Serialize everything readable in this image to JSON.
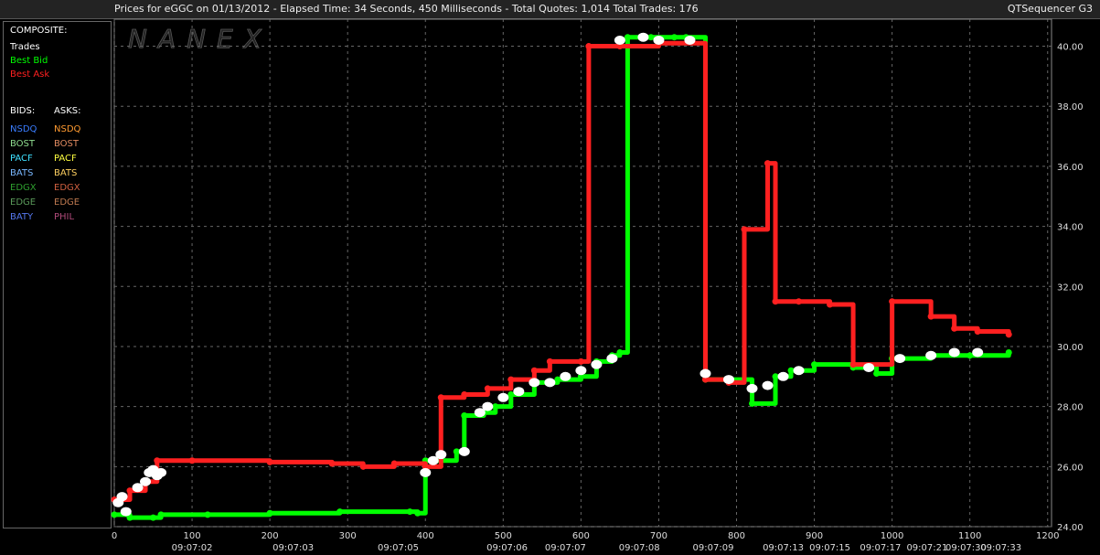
{
  "header": {
    "title": "Prices for  eGGC  on  01/13/2012  -  Elapsed Time: 34 Seconds, 450 Milliseconds  -  Total Quotes: 1,014  Total Trades: 176",
    "app_name": "QTSequencer G3"
  },
  "watermark": "NANEX",
  "legend": {
    "composite_title": "COMPOSITE:",
    "composite": [
      {
        "label": "Trades",
        "color": "#ffffff"
      },
      {
        "label": "Best Bid",
        "color": "#00ff00"
      },
      {
        "label": "Best Ask",
        "color": "#ff2020"
      }
    ],
    "bids_title": "BIDS:",
    "asks_title": "ASKS:",
    "bids": [
      {
        "label": "NSDQ",
        "color": "#3a7dff"
      },
      {
        "label": "BOST",
        "color": "#8fdc8f"
      },
      {
        "label": "PACF",
        "color": "#3ee0ff"
      },
      {
        "label": "BATS",
        "color": "#7ab8ff"
      },
      {
        "label": "EDGX",
        "color": "#2e9e2e"
      },
      {
        "label": "EDGE",
        "color": "#5a9a5a"
      },
      {
        "label": "BATY",
        "color": "#5577ee"
      }
    ],
    "asks": [
      {
        "label": "NSDQ",
        "color": "#ff9a30"
      },
      {
        "label": "BOST",
        "color": "#e08a60"
      },
      {
        "label": "PACF",
        "color": "#ffff40"
      },
      {
        "label": "BATS",
        "color": "#ffd060"
      },
      {
        "label": "EDGX",
        "color": "#d06040"
      },
      {
        "label": "EDGE",
        "color": "#c07a50"
      },
      {
        "label": "PHIL",
        "color": "#b04a7a"
      }
    ]
  },
  "chart_data": {
    "type": "line",
    "x_ticks": [
      0,
      100,
      200,
      300,
      400,
      500,
      600,
      700,
      800,
      900,
      1000,
      1100,
      1200
    ],
    "time_labels": [
      {
        "x": 100,
        "t": "09:07:02"
      },
      {
        "x": 230,
        "t": "09:07:03"
      },
      {
        "x": 365,
        "t": "09:07:05"
      },
      {
        "x": 505,
        "t": "09:07:06"
      },
      {
        "x": 580,
        "t": "09:07:07"
      },
      {
        "x": 675,
        "t": "09:07:08"
      },
      {
        "x": 770,
        "t": "09:07:09"
      },
      {
        "x": 860,
        "t": "09:07:13"
      },
      {
        "x": 920,
        "t": "09:07:15"
      },
      {
        "x": 985,
        "t": "09:07:17"
      },
      {
        "x": 1045,
        "t": "09:07:21"
      },
      {
        "x": 1095,
        "t": "09:07:30"
      },
      {
        "x": 1140,
        "t": "09:07:33"
      }
    ],
    "y_ticks": [
      24.0,
      26.0,
      28.0,
      30.0,
      32.0,
      34.0,
      36.0,
      38.0,
      40.0
    ],
    "y_tick_labels": [
      "24.00",
      "26.00",
      "28.00",
      "30.00",
      "32.00",
      "34.00",
      "36.00",
      "38.00",
      "40.00"
    ],
    "xlim": [
      0,
      1205
    ],
    "ylim": [
      24.0,
      40.9
    ],
    "grid": true,
    "series": [
      {
        "name": "Best Bid",
        "color": "#00ff00",
        "points": [
          [
            0,
            24.4
          ],
          [
            20,
            24.3
          ],
          [
            50,
            24.3
          ],
          [
            60,
            24.4
          ],
          [
            120,
            24.4
          ],
          [
            200,
            24.45
          ],
          [
            290,
            24.5
          ],
          [
            380,
            24.5
          ],
          [
            390,
            24.45
          ],
          [
            400,
            26.2
          ],
          [
            440,
            26.5
          ],
          [
            450,
            27.7
          ],
          [
            475,
            27.8
          ],
          [
            490,
            28.0
          ],
          [
            510,
            28.4
          ],
          [
            540,
            28.8
          ],
          [
            570,
            28.9
          ],
          [
            600,
            29.0
          ],
          [
            620,
            29.5
          ],
          [
            640,
            29.7
          ],
          [
            650,
            29.8
          ],
          [
            660,
            40.3
          ],
          [
            690,
            40.3
          ],
          [
            720,
            40.3
          ],
          [
            735,
            40.3
          ],
          [
            760,
            28.9
          ],
          [
            790,
            28.9
          ],
          [
            820,
            28.1
          ],
          [
            850,
            29.0
          ],
          [
            870,
            29.2
          ],
          [
            900,
            29.4
          ],
          [
            950,
            29.3
          ],
          [
            980,
            29.1
          ],
          [
            1000,
            29.6
          ],
          [
            1050,
            29.7
          ],
          [
            1100,
            29.7
          ],
          [
            1150,
            29.8
          ]
        ]
      },
      {
        "name": "Best Ask",
        "color": "#ff2020",
        "points": [
          [
            0,
            24.9
          ],
          [
            20,
            25.2
          ],
          [
            40,
            25.5
          ],
          [
            55,
            26.2
          ],
          [
            100,
            26.2
          ],
          [
            200,
            26.15
          ],
          [
            280,
            26.1
          ],
          [
            320,
            26.0
          ],
          [
            360,
            26.1
          ],
          [
            400,
            26.0
          ],
          [
            420,
            28.3
          ],
          [
            450,
            28.4
          ],
          [
            480,
            28.6
          ],
          [
            510,
            28.9
          ],
          [
            540,
            29.2
          ],
          [
            560,
            29.5
          ],
          [
            600,
            29.5
          ],
          [
            610,
            40.0
          ],
          [
            650,
            40.0
          ],
          [
            700,
            40.1
          ],
          [
            760,
            28.9
          ],
          [
            790,
            28.8
          ],
          [
            810,
            33.9
          ],
          [
            840,
            36.1
          ],
          [
            850,
            31.5
          ],
          [
            880,
            31.5
          ],
          [
            920,
            31.4
          ],
          [
            950,
            29.4
          ],
          [
            1000,
            31.5
          ],
          [
            1050,
            31.0
          ],
          [
            1080,
            30.6
          ],
          [
            1110,
            30.5
          ],
          [
            1150,
            30.4
          ]
        ]
      }
    ],
    "trades": [
      [
        5,
        24.8
      ],
      [
        10,
        25.0
      ],
      [
        15,
        24.5
      ],
      [
        30,
        25.3
      ],
      [
        40,
        25.5
      ],
      [
        45,
        25.8
      ],
      [
        50,
        25.9
      ],
      [
        55,
        25.7
      ],
      [
        60,
        25.8
      ],
      [
        400,
        25.8
      ],
      [
        410,
        26.2
      ],
      [
        420,
        26.4
      ],
      [
        450,
        26.5
      ],
      [
        470,
        27.8
      ],
      [
        480,
        28.0
      ],
      [
        500,
        28.3
      ],
      [
        520,
        28.5
      ],
      [
        540,
        28.8
      ],
      [
        560,
        28.8
      ],
      [
        580,
        29.0
      ],
      [
        600,
        29.2
      ],
      [
        620,
        29.4
      ],
      [
        640,
        29.6
      ],
      [
        650,
        40.2
      ],
      [
        680,
        40.3
      ],
      [
        700,
        40.2
      ],
      [
        740,
        40.2
      ],
      [
        760,
        29.1
      ],
      [
        790,
        28.9
      ],
      [
        820,
        28.6
      ],
      [
        840,
        28.7
      ],
      [
        860,
        29.0
      ],
      [
        880,
        29.2
      ],
      [
        970,
        29.3
      ],
      [
        1010,
        29.6
      ],
      [
        1050,
        29.7
      ],
      [
        1080,
        29.8
      ],
      [
        1110,
        29.8
      ]
    ]
  }
}
